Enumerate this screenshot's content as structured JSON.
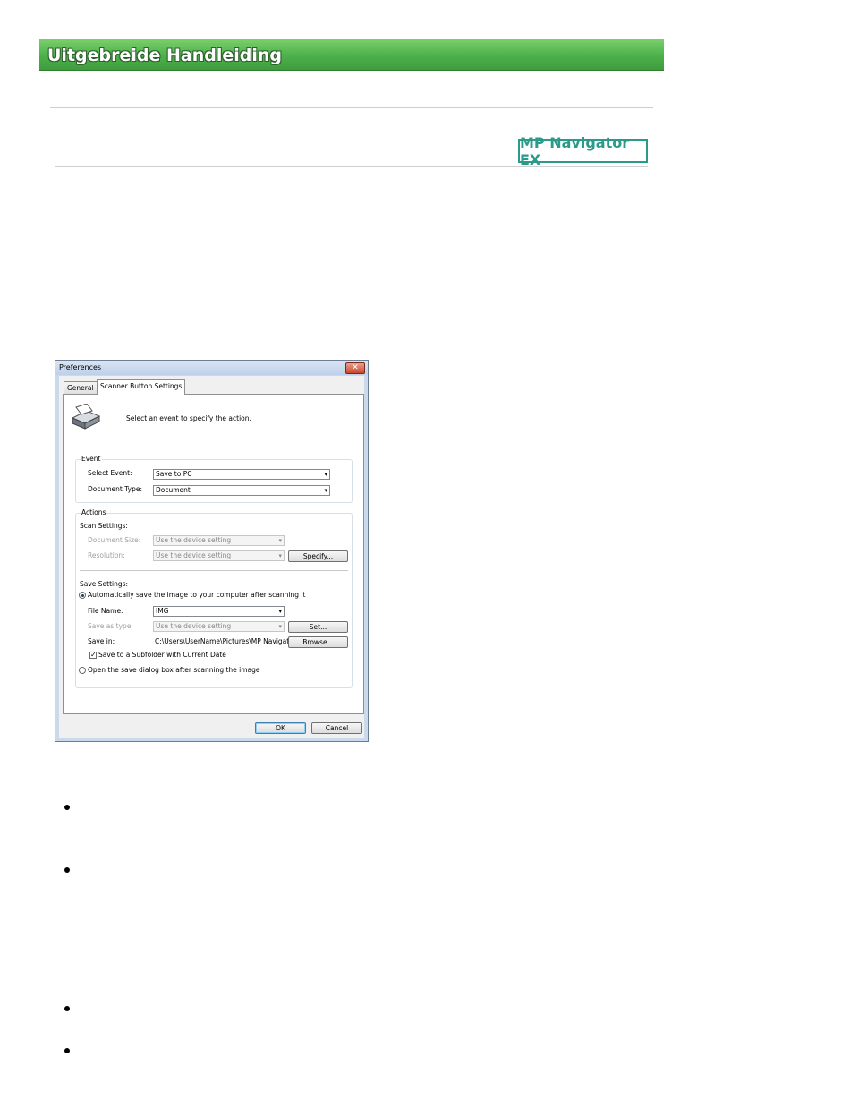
{
  "header": {
    "title": "Uitgebreide Handleiding"
  },
  "logo": {
    "text": "MP Navigator EX"
  },
  "dialog": {
    "title": "Preferences",
    "close_glyph": "✕",
    "tabs": [
      "General",
      "Scanner Button Settings"
    ],
    "intro": "Select an event to specify the action.",
    "event": {
      "title": "Event",
      "select_event_label": "Select Event:",
      "select_event_value": "Save to PC",
      "document_type_label": "Document Type:",
      "document_type_value": "Document"
    },
    "actions": {
      "title": "Actions",
      "scan_settings_label": "Scan Settings:",
      "document_size_label": "Document Size:",
      "document_size_value": "Use the device setting",
      "resolution_label": "Resolution:",
      "resolution_value": "Use the device setting",
      "specify_button": "Specify...",
      "save_settings_label": "Save Settings:",
      "auto_save_option": "Automatically save the image to your computer after scanning it",
      "file_name_label": "File Name:",
      "file_name_value": "IMG",
      "save_as_type_label": "Save as type:",
      "save_as_type_value": "Use the device setting",
      "set_button": "Set...",
      "save_in_label": "Save in:",
      "save_in_value": "C:\\Users\\UserName\\Pictures\\MP Navigat",
      "browse_button": "Browse...",
      "subfolder_checkbox": "Save to a Subfolder with Current Date",
      "subfolder_checked": true,
      "open_dialog_option": "Open the save dialog box after scanning the image",
      "selected_option": "auto_save"
    },
    "ok_button": "OK",
    "cancel_button": "Cancel",
    "check_glyph": "✓",
    "arrow_glyph": "▾"
  }
}
